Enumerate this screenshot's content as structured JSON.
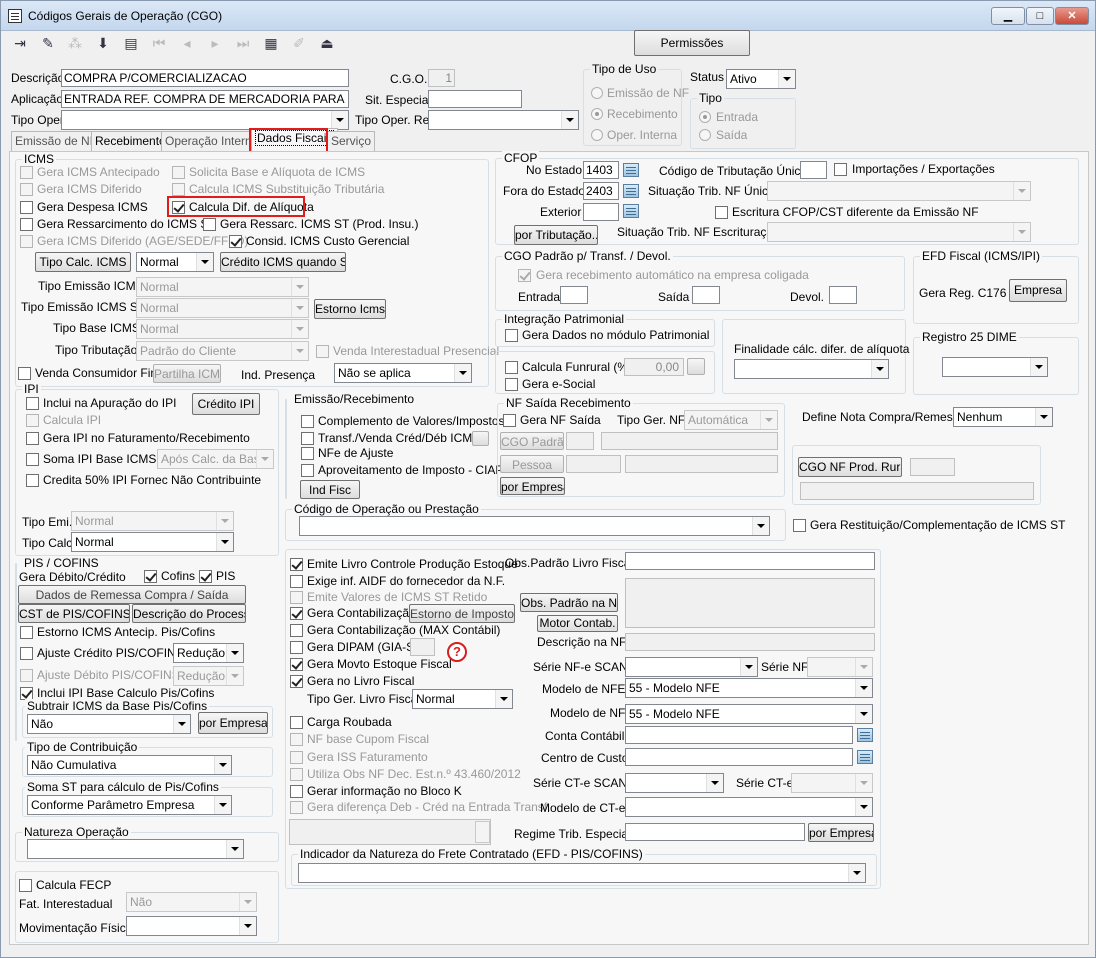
{
  "window": {
    "title": "Códigos Gerais de Operação (CGO)"
  },
  "toolbar": {
    "icons": [
      "exit-icon",
      "eraser-icon",
      "tree-icon",
      "save-icon",
      "print-icon",
      "first-icon",
      "previous-icon",
      "next-icon",
      "last-icon",
      "grid-icon",
      "edit-icon",
      "eject-icon"
    ],
    "permissions_label": "Permissões"
  },
  "header": {
    "descricao_label": "Descrição",
    "descricao_value": "COMPRA P/COMERCIALIZACAO",
    "cgo_label": "C.G.O.",
    "cgo_value": "1",
    "aplicacao_label": "Aplicação",
    "aplicacao_value": "ENTRADA REF. COMPRA DE MERCADORIA PARA REVE",
    "sit_especial_label": "Sit. Especial",
    "tipo_oper_label": "Tipo Oper.",
    "tipo_oper_rel_label": "Tipo Oper. Rel.",
    "tipo_uso_title": "Tipo de Uso",
    "tipo_uso_options": [
      "Emissão de NF",
      "Recebimento",
      "Oper. Interna"
    ],
    "status_label": "Status",
    "status_value": "Ativo",
    "tipo_title": "Tipo",
    "tipo_options": [
      "Entrada",
      "Saída"
    ]
  },
  "tabs": [
    "Emissão de NF",
    "Recebimento",
    "Operação Interna",
    "Dados Fiscais",
    "Serviço"
  ],
  "icms": {
    "title": "ICMS",
    "antecipado": "Gera ICMS Antecipado",
    "solicita_base": "Solicita Base e Alíquota de ICMS",
    "diferido": "Gera ICMS Diferido",
    "calcula_st": "Calcula ICMS Substituição Tributária",
    "despesa": "Gera Despesa ICMS",
    "calcula_dif": "Calcula Dif. de Alíquota",
    "ressarcimento": "Gera Ressarcimento do ICMS ST",
    "ressarc_prod": "Gera Ressarc. ICMS ST (Prod. Insu.)",
    "diferido_age": "Gera ICMS Diferido (AGE/SEDE/FFFD)",
    "consid_custo": "Consid. ICMS Custo Gerencial",
    "tipo_calc_btn": "Tipo Calc. ICMS",
    "tipo_calc_value": "Normal",
    "credito_st_btn": "Crédito ICMS quando ST",
    "tipo_emissao_label": "Tipo Emissão ICMS",
    "tipo_emissao_value": "Normal",
    "tipo_emissao_st_label": "Tipo Emissão ICMS ST",
    "tipo_emissao_st_value": "Normal",
    "estorno_btn": "Estorno Icms",
    "tipo_base_label": "Tipo Base ICMS",
    "tipo_base_value": "Normal",
    "tipo_trib_label": "Tipo Tributação",
    "tipo_trib_value": "Padrão do Cliente",
    "venda_interestadual": "Venda Interestadual Presencial",
    "venda_consumidor": "Venda Consumidor Final",
    "partilha_btn": "Partilha ICMS",
    "ind_presenca_label": "Ind. Presença",
    "ind_presenca_value": "Não se aplica"
  },
  "cfop": {
    "title": "CFOP",
    "no_estado_label": "No Estado",
    "no_estado_value": "1403",
    "fora_estado_label": "Fora do Estado",
    "fora_estado_value": "2403",
    "exterior_label": "Exterior",
    "por_tributacao_btn": "por Tributação...",
    "cod_trib_label": "Código de Tributação Único",
    "importacoes": "Importações / Exportações",
    "sit_trib_unica_label": "Situação Trib. NF Única",
    "escritura_cfop": "Escritura CFOP/CST diferente da Emissão NF",
    "sit_trib_escrit_label": "Situação Trib. NF Escrituração"
  },
  "cgo_padrao": {
    "title": "CGO Padrão p/ Transf. / Devol.",
    "gera_recebimento": "Gera recebimento automático na empresa coligada",
    "entrada_label": "Entrada",
    "saida_label": "Saída",
    "devol_label": "Devol."
  },
  "efd": {
    "title": "EFD Fiscal (ICMS/IPI)",
    "gera_reg_label": "Gera Reg. C176",
    "empresa_btn": "Empresa"
  },
  "integracao": {
    "title": "Integração Patrimonial",
    "gera_dados": "Gera Dados no módulo Patrimonial"
  },
  "finalidade": {
    "label": "Finalidade cálc. difer. de alíquota"
  },
  "registro25": {
    "title": "Registro 25 DIME"
  },
  "funrural": {
    "label": "Calcula Funrural (%)",
    "value": "0,00",
    "e_social": "Gera e-Social"
  },
  "ipi": {
    "title": "IPI",
    "inclui_apuracao": "Inclui na Apuração do IPI",
    "credito_btn": "Crédito IPI",
    "calcula": "Calcula IPI",
    "gera_faturamento": "Gera IPI no Faturamento/Recebimento",
    "soma_base": "Soma IPI Base ICMS",
    "soma_base_value": "Após Calc. da Base",
    "credita50": "Credita 50% IPI Fornec Não Contribuinte",
    "tipo_emi_label": "Tipo Emi.",
    "tipo_emi_value": "Normal",
    "tipo_calc_label": "Tipo Calc.",
    "tipo_calc_value": "Normal"
  },
  "emissao": {
    "title": "Emissão/Recebimento",
    "complemento": "Complemento de Valores/Impostos",
    "transf": "Transf./Venda Créd/Déb ICMS",
    "nfe_ajuste": "NFe de Ajuste",
    "aproveitamento": "Aproveitamento de Imposto - CIAP",
    "ind_fisc_btn": "Ind Fisc"
  },
  "nf_saida": {
    "title": "NF Saída Recebimento",
    "gera_nf": "Gera NF Saída",
    "tipo_ger_label": "Tipo Ger. NF",
    "tipo_ger_value": "Automática",
    "cgo_padrao_btn": "CGO Padrão",
    "pessoa_btn": "Pessoa",
    "por_empresa_btn": "por Empresa"
  },
  "define_nota": {
    "label": "Define Nota Compra/Remessa",
    "value": "Nenhum"
  },
  "cgo_prod_rural": {
    "btn": "CGO NF Prod. Rural"
  },
  "codigo_operacao": {
    "title": "Código de Operação ou Prestação"
  },
  "gera_restituicao": "Gera Restituição/Complementação de ICMS ST",
  "pis": {
    "title": "PIS / COFINS",
    "gera_label": "Gera Débito/Crédito",
    "cofins": "Cofins",
    "pis": "PIS",
    "dados_remessa_btn": "Dados de Remessa Compra / Saída",
    "cst_btn": "CST de PIS/COFINS",
    "descricao_btn": "Descrição do Processo",
    "estorno": "Estorno ICMS Antecip. Pis/Cofins",
    "ajuste_credito": "Ajuste Crédito PIS/COFINS",
    "ajuste_credito_value": "Redução",
    "ajuste_debito": "Ajuste Débito PIS/COFINS",
    "ajuste_debito_value": "Redução",
    "inclui_ipi": "Inclui IPI Base Calculo Pis/Cofins",
    "subtrair_title": "Subtrair ICMS da Base Pis/Cofins",
    "subtrair_value": "Não",
    "por_empresa_btn": "por Empresa"
  },
  "tipo_contrib": {
    "title": "Tipo de Contribuição",
    "value": "Não Cumulativa"
  },
  "soma_st": {
    "title": "Soma ST para cálculo de Pis/Cofins",
    "value": "Conforme Parâmetro Empresa"
  },
  "natureza": {
    "title": "Natureza Operação"
  },
  "fecp": {
    "calcula": "Calcula FECP",
    "fat_label": "Fat. Interestadual",
    "fat_value": "Não",
    "mov_label": "Movimentação Física"
  },
  "livro": {
    "emite_livro": "Emite Livro Controle Produção Estoque",
    "exige_aidf": "Exige inf. AIDF do fornecedor da N.F.",
    "emite_st_retido": "Emite Valores de ICMS ST Retido",
    "gera_contab": "Gera Contabilização",
    "estorno_btn": "Estorno de Impostos",
    "gera_contab_max": "Gera Contabilização (MAX Contábil)",
    "gera_dipam": "Gera DIPAM (GIA-SP)",
    "gera_movto": "Gera Movto Estoque Fiscal",
    "gera_livro": "Gera no Livro Fiscal",
    "tipo_ger_label": "Tipo Ger. Livro Fiscal",
    "tipo_ger_value": "Normal",
    "carga_roubada": "Carga Roubada",
    "nf_cupom": "NF base Cupom Fiscal",
    "gera_iss": "Gera ISS Faturamento",
    "utiliza_obs": "Utiliza Obs NF Dec. Est.n.º 43.460/2012",
    "gerar_bloco_k": "Gerar informação no Bloco K",
    "gera_diferenca": "Gera diferença Deb - Créd na Entrada Transf."
  },
  "fiscal_right": {
    "obs_padrao_label": "Obs.Padrão Livro Fiscal",
    "obs_padrao_nf_btn": "Obs. Padrão na NF",
    "motor_btn": "Motor Contab.",
    "descricao_nf_label": "Descrição na NF",
    "serie_scan_label": "Série NF-e SCAN",
    "serie_nf_label": "Série NF",
    "modelo_nfe_label": "Modelo de NFE",
    "modelo_nfe_value": "55 - Modelo NFE",
    "modelo_nf_label": "Modelo de NF",
    "modelo_nf_value": "55 - Modelo NFE",
    "conta_contabil_label": "Conta Contábil",
    "centro_custo_label": "Centro de Custo",
    "serie_cte_scan_label": "Série CT-e SCAN",
    "serie_cte_label": "Série CT-e",
    "modelo_cte_label": "Modelo de CT-e",
    "regime_label": "Regime Trib. Especial",
    "por_empresa_btn": "por Empresa"
  },
  "frete": {
    "title": "Indicador da Natureza do Frete Contratado (EFD - PIS/COFINS)"
  },
  "colors": {
    "highlight": "#e21b1b",
    "titlebar": "#c4d7ee"
  }
}
